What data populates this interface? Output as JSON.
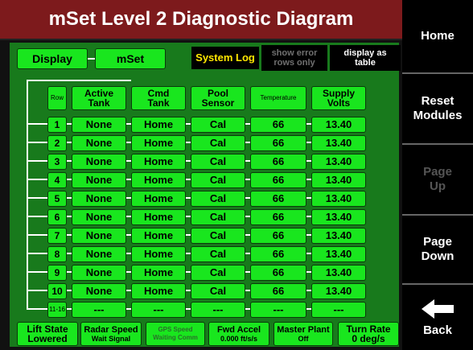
{
  "title": "mSet Level 2 Diagnostic Diagram",
  "top_buttons": {
    "display": "Display",
    "mset": "mSet"
  },
  "system_log": "System Log",
  "show_error": [
    "show error",
    "rows only"
  ],
  "display_as_table": [
    "display as",
    "table"
  ],
  "headers": {
    "row": "Row",
    "active_tank": [
      "Active",
      "Tank"
    ],
    "cmd_tank": [
      "Cmd",
      "Tank"
    ],
    "pool_sensor": [
      "Pool",
      "Sensor"
    ],
    "temperature": "Temperature",
    "supply_volts": [
      "Supply",
      "Volts"
    ]
  },
  "rows": [
    {
      "num": "1",
      "active": "None",
      "cmd": "Home",
      "pool": "Cal",
      "temp": "66",
      "volts": "13.40"
    },
    {
      "num": "2",
      "active": "None",
      "cmd": "Home",
      "pool": "Cal",
      "temp": "66",
      "volts": "13.40"
    },
    {
      "num": "3",
      "active": "None",
      "cmd": "Home",
      "pool": "Cal",
      "temp": "66",
      "volts": "13.40"
    },
    {
      "num": "4",
      "active": "None",
      "cmd": "Home",
      "pool": "Cal",
      "temp": "66",
      "volts": "13.40"
    },
    {
      "num": "5",
      "active": "None",
      "cmd": "Home",
      "pool": "Cal",
      "temp": "66",
      "volts": "13.40"
    },
    {
      "num": "6",
      "active": "None",
      "cmd": "Home",
      "pool": "Cal",
      "temp": "66",
      "volts": "13.40"
    },
    {
      "num": "7",
      "active": "None",
      "cmd": "Home",
      "pool": "Cal",
      "temp": "66",
      "volts": "13.40"
    },
    {
      "num": "8",
      "active": "None",
      "cmd": "Home",
      "pool": "Cal",
      "temp": "66",
      "volts": "13.40"
    },
    {
      "num": "9",
      "active": "None",
      "cmd": "Home",
      "pool": "Cal",
      "temp": "66",
      "volts": "13.40"
    },
    {
      "num": "10",
      "active": "None",
      "cmd": "Home",
      "pool": "Cal",
      "temp": "66",
      "volts": "13.40"
    },
    {
      "num": "11-16",
      "active": "---",
      "cmd": "---",
      "pool": "---",
      "temp": "---",
      "volts": "---"
    }
  ],
  "status": [
    {
      "l1": "Lift State",
      "l2": "Lowered",
      "style": "big"
    },
    {
      "l1": "Radar Speed",
      "l2": "Wait Signal",
      "style": "normal"
    },
    {
      "l1": "GPS Speed",
      "l2": "Waiting Comm",
      "style": "dim"
    },
    {
      "l1": "Fwd Accel",
      "l2": "0.000 ft/s/s",
      "style": "normal"
    },
    {
      "l1": "Master Plant",
      "l2": "Off",
      "style": "normal"
    },
    {
      "l1": "Turn Rate",
      "l2": "0 deg/s",
      "style": "big"
    }
  ],
  "side": {
    "home": "Home",
    "reset": [
      "Reset",
      "Modules"
    ],
    "page_up": [
      "Page",
      "Up"
    ],
    "page_down": [
      "Page",
      "Down"
    ],
    "back": "Back"
  },
  "colors": {
    "title_bg": "#7d1a1c",
    "panel_bg": "#187a1c",
    "button_green": "#19e61e",
    "log_yellow": "#ffe700"
  },
  "icons": {
    "back": "left-arrow-icon"
  }
}
